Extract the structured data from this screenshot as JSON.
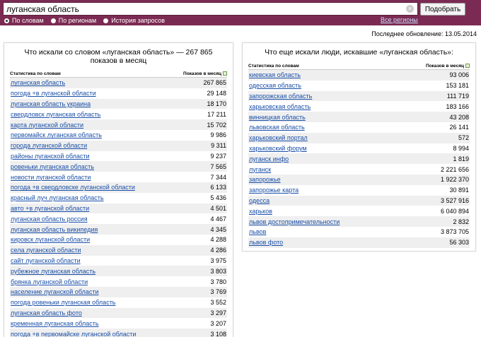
{
  "search": {
    "query": "луганская область",
    "submit_label": "Подобрать",
    "modes": [
      {
        "label": "По словам",
        "selected": true
      },
      {
        "label": "По регионам",
        "selected": false
      },
      {
        "label": "История запросов",
        "selected": false
      }
    ],
    "all_regions": "Все регионы"
  },
  "last_update": "Последнее обновление: 13.05.2014",
  "left": {
    "title_line1": "Что искали со словом «луганская область» — 267 865",
    "title_line2": "показов в месяц",
    "col_phrase": "Статистика по словам",
    "col_count": "Показов в месяц",
    "rows": [
      {
        "phrase": "луганская область",
        "count": "267 865"
      },
      {
        "phrase": "погода +в луганской области",
        "count": "29 148"
      },
      {
        "phrase": "луганская область украина",
        "count": "18 170"
      },
      {
        "phrase": "свердловск луганская область",
        "count": "17 211"
      },
      {
        "phrase": "карта луганской области",
        "count": "15 702"
      },
      {
        "phrase": "первомайск луганская область",
        "count": "9 986"
      },
      {
        "phrase": "города луганской области",
        "count": "9 311"
      },
      {
        "phrase": "районы луганской области",
        "count": "9 237"
      },
      {
        "phrase": "ровеньки луганская область",
        "count": "7 565"
      },
      {
        "phrase": "новости луганской области",
        "count": "7 344"
      },
      {
        "phrase": "погода +в свердловске луганской области",
        "count": "6 133"
      },
      {
        "phrase": "красный луч луганская область",
        "count": "5 436"
      },
      {
        "phrase": "авто +в луганской области",
        "count": "4 501"
      },
      {
        "phrase": "луганская область россия",
        "count": "4 467"
      },
      {
        "phrase": "луганская область википедия",
        "count": "4 345"
      },
      {
        "phrase": "кировск луганской области",
        "count": "4 288"
      },
      {
        "phrase": "села луганской области",
        "count": "4 286"
      },
      {
        "phrase": "сайт луганской области",
        "count": "3 975"
      },
      {
        "phrase": "рубежное луганская область",
        "count": "3 803"
      },
      {
        "phrase": "брянка луганской области",
        "count": "3 780"
      },
      {
        "phrase": "население луганской области",
        "count": "3 769"
      },
      {
        "phrase": "погода ровеньки луганская область",
        "count": "3 552"
      },
      {
        "phrase": "луганская область фото",
        "count": "3 297"
      },
      {
        "phrase": "кременная луганская область",
        "count": "3 207"
      },
      {
        "phrase": "погода +в первомайске луганской области",
        "count": "3 108"
      }
    ]
  },
  "right": {
    "title": "Что еще искали люди, искавшие «луганская область»:",
    "col_phrase": "Статистика по словам",
    "col_count": "Показов в месяц",
    "rows": [
      {
        "phrase": "киевская область",
        "count": "93 006"
      },
      {
        "phrase": "одесская область",
        "count": "153 181"
      },
      {
        "phrase": "запорожская область",
        "count": "111 719"
      },
      {
        "phrase": "харьковская область",
        "count": "183 166"
      },
      {
        "phrase": "винницкая область",
        "count": "43 208"
      },
      {
        "phrase": "львовская область",
        "count": "26 141"
      },
      {
        "phrase": "харьковский портал",
        "count": "572"
      },
      {
        "phrase": "харьковский форум",
        "count": "8 994"
      },
      {
        "phrase": "луганск инфо",
        "count": "1 819"
      },
      {
        "phrase": "луганск",
        "count": "2 221 656"
      },
      {
        "phrase": "запорожье",
        "count": "1 922 370"
      },
      {
        "phrase": "запорожье карта",
        "count": "30 891"
      },
      {
        "phrase": "одесса",
        "count": "3 527 916"
      },
      {
        "phrase": "харьков",
        "count": "6 040 894"
      },
      {
        "phrase": "львов достопримечательности",
        "count": "2 832"
      },
      {
        "phrase": "львов",
        "count": "3 873 705"
      },
      {
        "phrase": "львов фото",
        "count": "56 303"
      }
    ]
  }
}
